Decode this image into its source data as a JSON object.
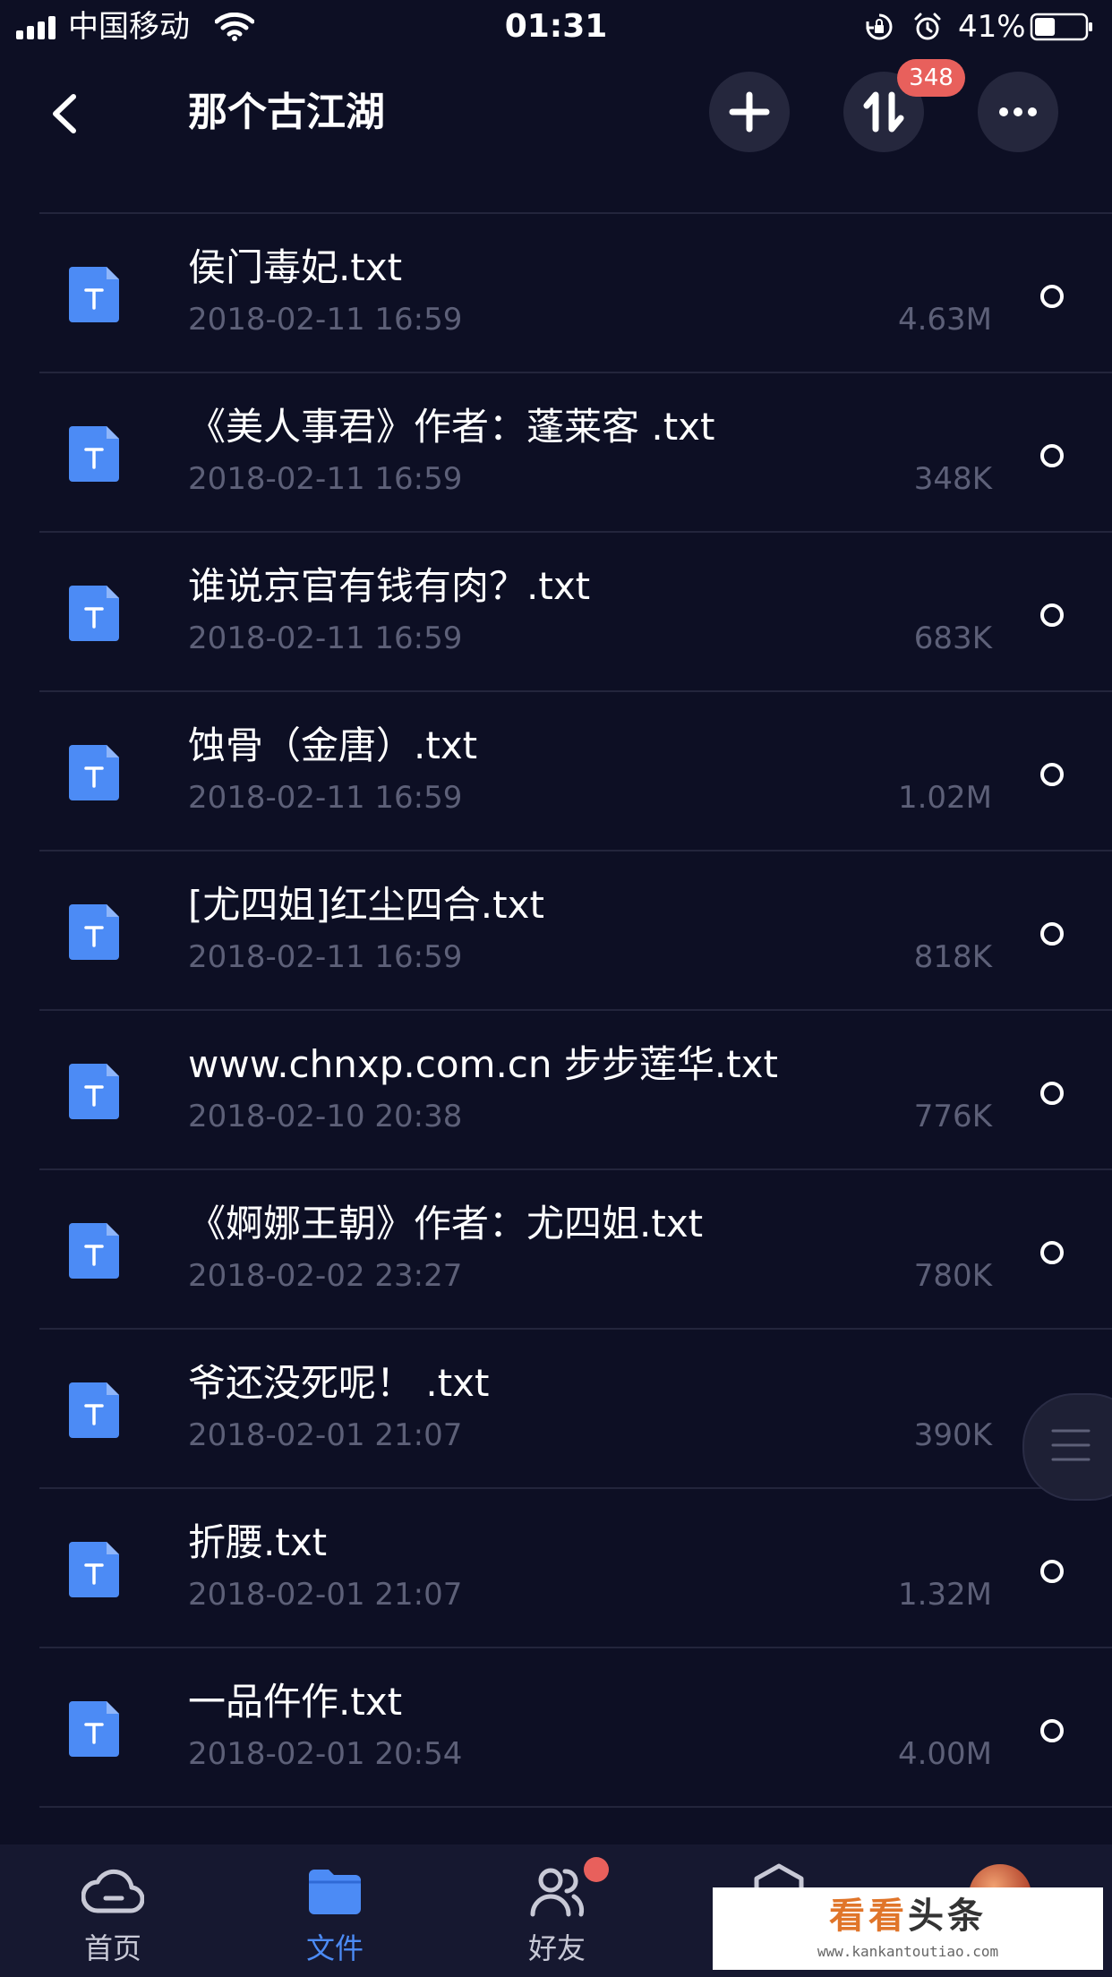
{
  "status_bar": {
    "carrier": "中国移动",
    "time": "01:31",
    "battery_percent": "41%",
    "battery_level": 0.41
  },
  "header": {
    "title": "那个古江湖",
    "transfer_badge": "348"
  },
  "files": [
    {
      "name": "侯门毒妃.txt",
      "date": "2018-02-11 16:59",
      "size": "4.63M"
    },
    {
      "name": "《美人事君》作者：蓬莱客 .txt",
      "date": "2018-02-11 16:59",
      "size": "348K"
    },
    {
      "name": "谁说京官有钱有肉？.txt",
      "date": "2018-02-11 16:59",
      "size": "683K"
    },
    {
      "name": "蚀骨（金唐）.txt",
      "date": "2018-02-11 16:59",
      "size": "1.02M"
    },
    {
      "name": "[尤四姐]红尘四合.txt",
      "date": "2018-02-11 16:59",
      "size": "818K"
    },
    {
      "name": "www.chnxp.com.cn 步步莲华.txt",
      "date": "2018-02-10 20:38",
      "size": "776K"
    },
    {
      "name": "《婀娜王朝》作者：尤四姐.txt",
      "date": "2018-02-02 23:27",
      "size": "780K"
    },
    {
      "name": "爷还没死呢！ .txt",
      "date": "2018-02-01 21:07",
      "size": "390K"
    },
    {
      "name": "折腰.txt",
      "date": "2018-02-01 21:07",
      "size": "1.32M"
    },
    {
      "name": "一品仵作.txt",
      "date": "2018-02-01 20:54",
      "size": "4.00M"
    }
  ],
  "tabs": {
    "home": "首页",
    "files": "文件",
    "friends": "好友"
  },
  "watermark": {
    "main_a": "看看",
    "main_b": "头条",
    "sub": "www.kankantoutiao.com"
  },
  "colors": {
    "background": "#0d0f24",
    "accent": "#4c8bf5",
    "badge": "#e8605c",
    "muted_text": "#5d6078"
  }
}
